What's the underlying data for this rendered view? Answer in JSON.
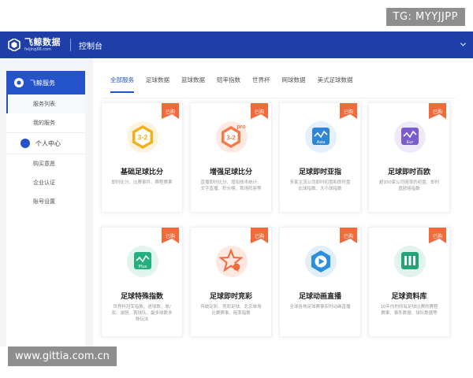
{
  "watermark": {
    "top": "TG: MYYJJPP",
    "bottom": "www.gittia.com.cn"
  },
  "header": {
    "logo_text": "飞鲸数据",
    "logo_url": "feijing88.com",
    "title": "控制台"
  },
  "sidebar": {
    "section_title": "飞鲸服务",
    "service_items": [
      "服务列表",
      "我的服务"
    ],
    "personal_title": "个人中心",
    "personal_items": [
      "购买意愿",
      "企业认证",
      "账号设置"
    ]
  },
  "tabs": [
    "全部服务",
    "足球数据",
    "篮球数据",
    "赔率指数",
    "世界杯",
    "网球数据",
    "美式足球数据"
  ],
  "active_tab": "全部服务",
  "cards": [
    {
      "title": "基础足球比分",
      "badge": "已购",
      "desc": "即时比分、比赛事件、赛程赛果",
      "icon": "football-score-3-2-icon",
      "color": "#f2b01e"
    },
    {
      "title": "增强足球比分",
      "badge": "已购",
      "desc": "直播即时比分、增加技术统计、文字直播、积分榜、首场阵容等",
      "icon": "football-score-pro-icon",
      "color": "#f47a4b"
    },
    {
      "title": "足球即时亚指",
      "badge": "已购",
      "desc": "多家主流公司即时初盘和即时盘比球指数、大小球指数",
      "icon": "asia-index-icon",
      "color": "#2d86d8"
    },
    {
      "title": "足球即时百欧",
      "badge": "已购",
      "desc": "超350家公司赔率的初盘、即时盘欧赔指数",
      "icon": "euro-index-icon",
      "color": "#7b5ccf"
    },
    {
      "title": "足球特殊指数",
      "badge": "已购",
      "desc": "世界杯冠军指数、进球数、单/双、波胆、首球队、最多球数多种玩法",
      "icon": "special-index-plus-icon",
      "color": "#23b07e"
    },
    {
      "title": "足球即时竞彩",
      "badge": "已购",
      "desc": "传统足彩、竞彩足球、北京单场比赛赛事、赔率指数",
      "icon": "lottery-star-icon",
      "color": "#f06a3c"
    },
    {
      "title": "足球动画直播",
      "badge": "已购",
      "desc": "全球各地足球赛事实时动画直播",
      "icon": "animation-play-icon",
      "color": "#2b8fe0"
    },
    {
      "title": "足球资料库",
      "badge": "已购",
      "desc": "10年内的所有足球比赛的赛程赛果、事件数据、球队数据等",
      "icon": "database-icon",
      "color": "#23a37a"
    }
  ]
}
